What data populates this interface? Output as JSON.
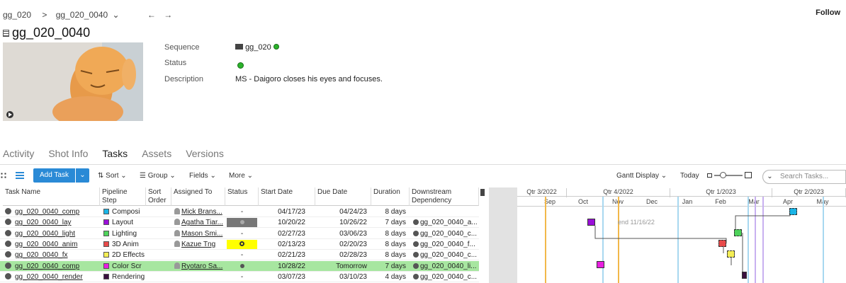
{
  "breadcrumb": {
    "parent": "gg_020",
    "sep": ">",
    "current": "gg_020_0040",
    "back": "←",
    "fwd": "→",
    "drop": "⌄"
  },
  "follow": "Follow",
  "title": "gg_020_0040",
  "fields": {
    "seq_label": "Sequence",
    "seq_value": "gg_020",
    "status_label": "Status",
    "desc_label": "Description",
    "desc_value": "MS - Daigoro closes his eyes and focuses."
  },
  "tabs": [
    "Activity",
    "Shot Info",
    "Tasks",
    "Assets",
    "Versions"
  ],
  "toolbar": {
    "add_task": "Add Task",
    "sort": "Sort",
    "group": "Group",
    "fields": "Fields",
    "more": "More",
    "gantt_display": "Gantt Display",
    "today": "Today",
    "search_placeholder": "Search Tasks..."
  },
  "columns": {
    "task": "Task Name",
    "pipe": "Pipeline Step",
    "sort1": "Sort",
    "sort2": "Order",
    "assigned": "Assigned To",
    "status": "Status",
    "start": "Start Date",
    "due": "Due Date",
    "duration": "Duration",
    "ds1": "Downstream",
    "ds2": "Dependency"
  },
  "rows": [
    {
      "name": "gg_020_0040_comp",
      "step": "Composi",
      "color": "#19b4e6",
      "assigned": "Mick Brans...",
      "status": "-",
      "start": "04/17/23",
      "due": "04/24/23",
      "duration": "8 days",
      "dep": ""
    },
    {
      "name": "gg_020_0040_lay",
      "step": "Layout",
      "color": "#9a0fd9",
      "assigned": "Agatha Tiar...",
      "status": "",
      "start": "10/20/22",
      "due": "10/26/22",
      "duration": "7 days",
      "dep": "gg_020_0040_a..."
    },
    {
      "name": "gg_020_0040_light",
      "step": "Lighting",
      "color": "#4ed35b",
      "assigned": "Mason Smi...",
      "status": "-",
      "start": "02/27/23",
      "due": "03/06/23",
      "duration": "8 days",
      "dep": "gg_020_0040_c..."
    },
    {
      "name": "gg_020_0040_anim",
      "step": "3D Anim",
      "color": "#e84a4a",
      "assigned": "Kazue Tng",
      "status": "",
      "start": "02/13/23",
      "due": "02/20/23",
      "duration": "8 days",
      "dep": "gg_020_0040_f..."
    },
    {
      "name": "gg_020_0040_fx",
      "step": "2D Effects",
      "color": "#f4ee55",
      "assigned": "",
      "status": "-",
      "start": "02/21/23",
      "due": "02/28/23",
      "duration": "8 days",
      "dep": "gg_020_0040_c..."
    },
    {
      "name": "gg_020_0040_comp",
      "step": "Color Scr",
      "color": "#e81ee0",
      "assigned": "Ryotaro Sa...",
      "status": "",
      "start": "10/28/22",
      "due": "Tomorrow",
      "duration": "7 days",
      "dep": "gg_020_0040_li..."
    },
    {
      "name": "gg_020_0040_render",
      "step": "Rendering",
      "color": "#3a0f3e",
      "assigned": "",
      "status": "-",
      "start": "03/07/23",
      "due": "03/10/23",
      "duration": "4 days",
      "dep": "gg_020_0040_c..."
    }
  ],
  "gantt": {
    "quarters": [
      "Qtr 3/2022",
      "Qtr 4/2022",
      "Qtr 1/2023",
      "Qtr 2/2023"
    ],
    "months": [
      "Sep",
      "Oct",
      "Nov",
      "Dec",
      "Jan",
      "Feb",
      "Mar",
      "Apr",
      "May"
    ],
    "end_note": "end 11/16/22"
  }
}
